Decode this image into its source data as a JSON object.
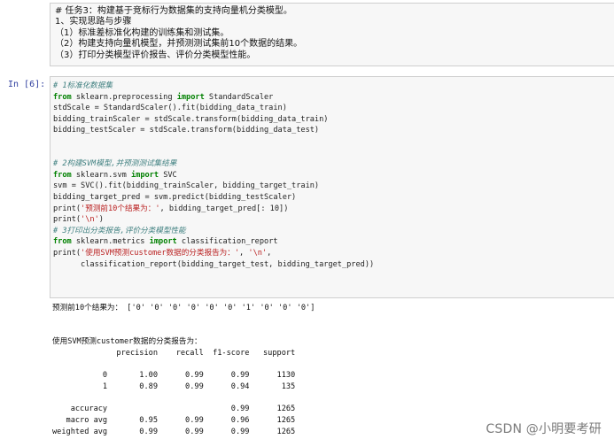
{
  "markdown": {
    "lines": [
      "# 任务3：构建基于竞标行为数据集的支持向量机分类模型。",
      "1、实现思路与步骤",
      "（1）标准差标准化构建的训练集和测试集。",
      "（2）构建支持向量机模型，并预测测试集前10个数据的结果。",
      "（3）打印分类模型评价报告、评价分类模型性能。"
    ]
  },
  "code_cell": {
    "prompt": "In [6]:",
    "lines": [
      "# 1标准化数据集",
      "from sklearn.preprocessing import StandardScaler",
      "stdScale = StandardScaler().fit(bidding_data_train)",
      "bidding_trainScaler = stdScale.transform(bidding_data_train)",
      "bidding_testScaler = stdScale.transform(bidding_data_test)",
      "",
      "",
      "# 2构建SVM模型,并预测测试集结果",
      "from sklearn.svm import SVC",
      "svm = SVC().fit(bidding_trainScaler, bidding_target_train)",
      "bidding_target_pred = svm.predict(bidding_testScaler)",
      "print('预测前10个结果为：', bidding_target_pred[: 10])",
      "print('\\n')",
      "# 3打印出分类报告,评价分类模型性能",
      "from sklearn.metrics import classification_report",
      "print('使用SVM预测customer数据的分类报告为：', '\\n',",
      "      classification_report(bidding_target_test, bidding_target_pred))"
    ]
  },
  "output": {
    "lines": [
      "预测前10个结果为： ['0' '0' '0' '0' '0' '0' '1' '0' '0' '0']",
      "",
      "",
      "使用SVM预测customer数据的分类报告为：",
      "              precision    recall  f1-score   support",
      "",
      "           0       1.00      0.99      0.99      1130",
      "           1       0.89      0.99      0.94       135",
      "",
      "    accuracy                           0.99      1265",
      "   macro avg       0.95      0.99      0.96      1265",
      "weighted avg       0.99      0.99      0.99      1265"
    ]
  },
  "watermark": "CSDN @小明要考研"
}
